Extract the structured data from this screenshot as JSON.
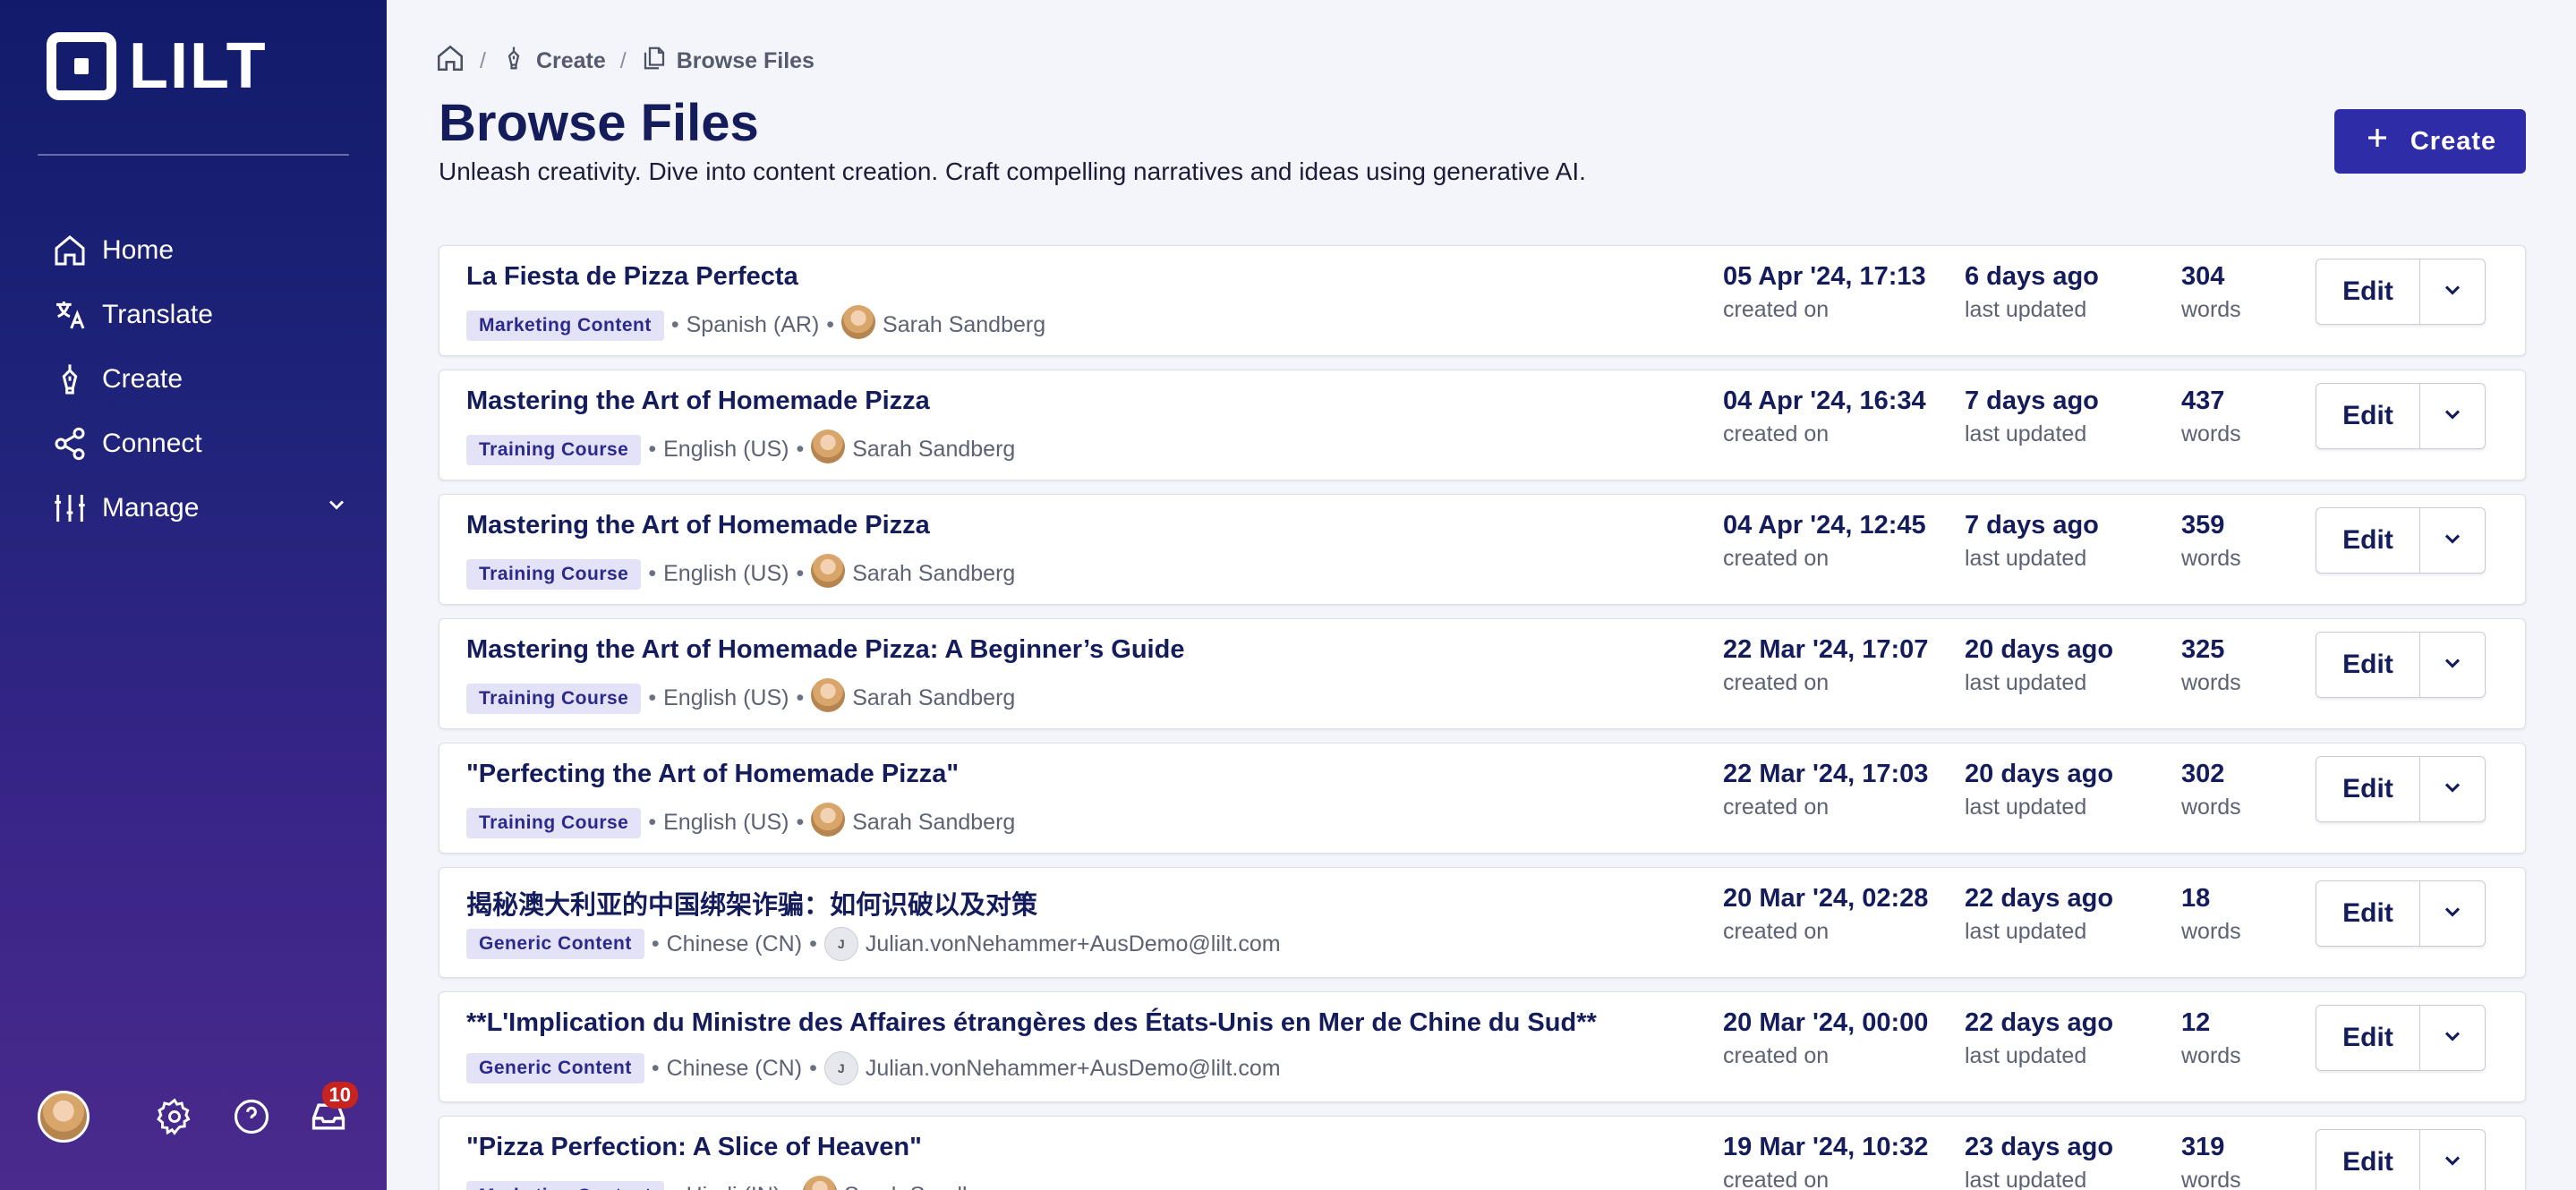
{
  "sidebar": {
    "logo_text": "LILT",
    "nav": [
      {
        "label": "Home",
        "icon": "home-icon"
      },
      {
        "label": "Translate",
        "icon": "translate-icon"
      },
      {
        "label": "Create",
        "icon": "pen-icon"
      },
      {
        "label": "Connect",
        "icon": "share-icon"
      },
      {
        "label": "Manage",
        "icon": "sliders-icon"
      }
    ],
    "notifications_count": "10"
  },
  "breadcrumb": {
    "items": [
      "Create",
      "Browse Files"
    ],
    "separator": "/"
  },
  "header": {
    "title": "Browse Files",
    "subtitle": "Unleash creativity. Dive into content creation. Craft compelling narratives and ideas using generative AI.",
    "create_label": "Create"
  },
  "labels": {
    "created_on": "created on",
    "last_updated": "last updated",
    "words": "words",
    "edit": "Edit"
  },
  "files": [
    {
      "title": "La Fiesta de Pizza Perfecta",
      "tag": "Marketing Content",
      "lang": "Spanish (AR)",
      "user": "Sarah Sandberg",
      "avatar": "photo",
      "created": "05 Apr '24, 17:13",
      "updated": "6 days ago",
      "words": "304"
    },
    {
      "title": "Mastering the Art of Homemade Pizza",
      "tag": "Training Course",
      "lang": "English (US)",
      "user": "Sarah Sandberg",
      "avatar": "photo",
      "created": "04 Apr '24, 16:34",
      "updated": "7 days ago",
      "words": "437"
    },
    {
      "title": "Mastering the Art of Homemade Pizza",
      "tag": "Training Course",
      "lang": "English (US)",
      "user": "Sarah Sandberg",
      "avatar": "photo",
      "created": "04 Apr '24, 12:45",
      "updated": "7 days ago",
      "words": "359"
    },
    {
      "title": "Mastering the Art of Homemade Pizza: A Beginner’s Guide",
      "tag": "Training Course",
      "lang": "English (US)",
      "user": "Sarah Sandberg",
      "avatar": "photo",
      "created": "22 Mar '24, 17:07",
      "updated": "20 days ago",
      "words": "325"
    },
    {
      "title": "\"Perfecting the Art of Homemade Pizza\"",
      "tag": "Training Course",
      "lang": "English (US)",
      "user": "Sarah Sandberg",
      "avatar": "photo",
      "created": "22 Mar '24, 17:03",
      "updated": "20 days ago",
      "words": "302"
    },
    {
      "title": "揭秘澳大利亚的中国绑架诈骗：如何识破以及对策",
      "tag": "Generic Content",
      "lang": "Chinese (CN)",
      "user": "Julian.vonNehammer+AusDemo@lilt.com",
      "avatar": "J",
      "created": "20 Mar '24, 02:28",
      "updated": "22 days ago",
      "words": "18"
    },
    {
      "title": "**L'Implication du Ministre des Affaires étrangères des États-Unis en Mer de Chine du Sud**",
      "tag": "Generic Content",
      "lang": "Chinese (CN)",
      "user": "Julian.vonNehammer+AusDemo@lilt.com",
      "avatar": "J",
      "created": "20 Mar '24, 00:00",
      "updated": "22 days ago",
      "words": "12"
    },
    {
      "title": "\"Pizza Perfection: A Slice of Heaven\"",
      "tag": "Marketing Content",
      "lang": "Hindi (IN)",
      "user": "Sarah Sandberg",
      "avatar": "photo",
      "created": "19 Mar '24, 10:32",
      "updated": "23 days ago",
      "words": "319"
    }
  ]
}
